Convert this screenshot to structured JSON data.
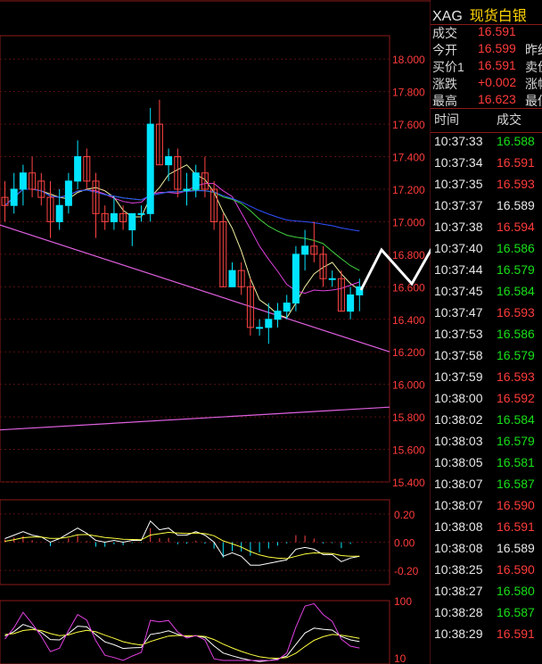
{
  "quote": {
    "symbol": "XAG",
    "name": "现货白银",
    "rows": [
      {
        "label": "成交",
        "value": "16.591",
        "extra": ""
      },
      {
        "label": "今开",
        "value": "16.599",
        "extra": "昨结"
      },
      {
        "label": "买价1",
        "value": "16.591",
        "extra": "卖价"
      },
      {
        "label": "涨跌",
        "value": "+0.002",
        "extra": "涨幅"
      },
      {
        "label": "最高",
        "value": "16.623",
        "extra": "最低"
      }
    ],
    "col_time": "时间",
    "col_price": "成交"
  },
  "ticks": [
    {
      "time": "10:37:33",
      "price": "16.588",
      "dir": "dn"
    },
    {
      "time": "10:37:34",
      "price": "16.591",
      "dir": "up"
    },
    {
      "time": "10:37:35",
      "price": "16.593",
      "dir": "up"
    },
    {
      "time": "10:37:37",
      "price": "16.589",
      "dir": "fl"
    },
    {
      "time": "10:37:38",
      "price": "16.594",
      "dir": "up"
    },
    {
      "time": "10:37:40",
      "price": "16.586",
      "dir": "dn"
    },
    {
      "time": "10:37:44",
      "price": "16.579",
      "dir": "dn"
    },
    {
      "time": "10:37:45",
      "price": "16.584",
      "dir": "dn"
    },
    {
      "time": "10:37:47",
      "price": "16.593",
      "dir": "up"
    },
    {
      "time": "10:37:53",
      "price": "16.586",
      "dir": "dn"
    },
    {
      "time": "10:37:58",
      "price": "16.579",
      "dir": "dn"
    },
    {
      "time": "10:37:59",
      "price": "16.593",
      "dir": "up"
    },
    {
      "time": "10:38:00",
      "price": "16.592",
      "dir": "up"
    },
    {
      "time": "10:38:02",
      "price": "16.584",
      "dir": "dn"
    },
    {
      "time": "10:38:03",
      "price": "16.579",
      "dir": "dn"
    },
    {
      "time": "10:38:05",
      "price": "16.581",
      "dir": "dn"
    },
    {
      "time": "10:38:07",
      "price": "16.587",
      "dir": "dn"
    },
    {
      "time": "10:38:07",
      "price": "16.590",
      "dir": "up"
    },
    {
      "time": "10:38:08",
      "price": "16.591",
      "dir": "up"
    },
    {
      "time": "10:38:08",
      "price": "16.589",
      "dir": "fl"
    },
    {
      "time": "10:38:25",
      "price": "16.590",
      "dir": "up"
    },
    {
      "time": "10:38:27",
      "price": "16.580",
      "dir": "dn"
    },
    {
      "time": "10:38:28",
      "price": "16.587",
      "dir": "dn"
    },
    {
      "time": "10:38:29",
      "price": "16.591",
      "dir": "up"
    }
  ],
  "colors": {
    "up": "#ff3b3b",
    "down": "#19e019",
    "bull_candle": "#00e5ff",
    "bear_candle": "#ff4444",
    "frame": "#8b1a1a",
    "axis_label": "#ff3b3b",
    "ma5": "#f0f0a0",
    "ma10": "#e040e0",
    "ma20": "#40d040",
    "ma60": "#3050ff",
    "trendline": "#e060e0",
    "arrow": "#ffffff"
  },
  "chart_data": {
    "type": "candlestick",
    "price_axis": {
      "ylim": [
        15.4,
        18.1
      ],
      "ticks": [
        "18.000",
        "17.800",
        "17.600",
        "17.400",
        "17.200",
        "17.000",
        "16.800",
        "16.600",
        "16.400",
        "16.200",
        "16.000",
        "15.800",
        "15.600",
        "15.400"
      ]
    },
    "candles": [
      {
        "o": 17.15,
        "h": 17.25,
        "l": 17.0,
        "c": 17.1
      },
      {
        "o": 17.1,
        "h": 17.3,
        "l": 17.05,
        "c": 17.2
      },
      {
        "o": 17.2,
        "h": 17.35,
        "l": 17.1,
        "c": 17.3
      },
      {
        "o": 17.3,
        "h": 17.4,
        "l": 17.15,
        "c": 17.2
      },
      {
        "o": 17.25,
        "h": 17.3,
        "l": 17.1,
        "c": 17.15
      },
      {
        "o": 17.15,
        "h": 17.25,
        "l": 16.9,
        "c": 17.0
      },
      {
        "o": 17.0,
        "h": 17.2,
        "l": 16.95,
        "c": 17.1
      },
      {
        "o": 17.1,
        "h": 17.3,
        "l": 17.05,
        "c": 17.25
      },
      {
        "o": 17.25,
        "h": 17.5,
        "l": 17.2,
        "c": 17.4
      },
      {
        "o": 17.4,
        "h": 17.45,
        "l": 17.2,
        "c": 17.25
      },
      {
        "o": 17.25,
        "h": 17.3,
        "l": 16.9,
        "c": 17.05
      },
      {
        "o": 17.05,
        "h": 17.1,
        "l": 16.95,
        "c": 17.0
      },
      {
        "o": 17.0,
        "h": 17.15,
        "l": 16.95,
        "c": 17.05
      },
      {
        "o": 17.05,
        "h": 17.1,
        "l": 16.95,
        "c": 17.0
      },
      {
        "o": 16.95,
        "h": 17.05,
        "l": 16.85,
        "c": 17.05
      },
      {
        "o": 17.05,
        "h": 17.1,
        "l": 17.0,
        "c": 17.05
      },
      {
        "o": 17.05,
        "h": 17.7,
        "l": 17.0,
        "c": 17.6
      },
      {
        "o": 17.6,
        "h": 17.75,
        "l": 17.35,
        "c": 17.35
      },
      {
        "o": 17.35,
        "h": 17.45,
        "l": 17.25,
        "c": 17.4
      },
      {
        "o": 17.4,
        "h": 17.45,
        "l": 17.15,
        "c": 17.2
      },
      {
        "o": 17.2,
        "h": 17.3,
        "l": 17.1,
        "c": 17.2
      },
      {
        "o": 17.2,
        "h": 17.35,
        "l": 17.15,
        "c": 17.3
      },
      {
        "o": 17.3,
        "h": 17.4,
        "l": 17.15,
        "c": 17.2
      },
      {
        "o": 17.2,
        "h": 17.25,
        "l": 16.95,
        "c": 17.0
      },
      {
        "o": 17.0,
        "h": 17.05,
        "l": 16.6,
        "c": 16.6
      },
      {
        "o": 16.6,
        "h": 16.75,
        "l": 16.6,
        "c": 16.7
      },
      {
        "o": 16.7,
        "h": 16.75,
        "l": 16.55,
        "c": 16.6
      },
      {
        "o": 16.6,
        "h": 16.65,
        "l": 16.3,
        "c": 16.35
      },
      {
        "o": 16.35,
        "h": 16.4,
        "l": 16.3,
        "c": 16.35
      },
      {
        "o": 16.35,
        "h": 16.5,
        "l": 16.25,
        "c": 16.4
      },
      {
        "o": 16.4,
        "h": 16.5,
        "l": 16.35,
        "c": 16.45
      },
      {
        "o": 16.45,
        "h": 16.55,
        "l": 16.4,
        "c": 16.5
      },
      {
        "o": 16.5,
        "h": 16.85,
        "l": 16.45,
        "c": 16.8
      },
      {
        "o": 16.8,
        "h": 16.95,
        "l": 16.7,
        "c": 16.85
      },
      {
        "o": 16.85,
        "h": 17.0,
        "l": 16.75,
        "c": 16.8
      },
      {
        "o": 16.8,
        "h": 16.85,
        "l": 16.6,
        "c": 16.65
      },
      {
        "o": 16.65,
        "h": 16.7,
        "l": 16.6,
        "c": 16.65
      },
      {
        "o": 16.65,
        "h": 16.7,
        "l": 16.45,
        "c": 16.45
      },
      {
        "o": 16.45,
        "h": 16.6,
        "l": 16.4,
        "c": 16.55
      },
      {
        "o": 16.55,
        "h": 16.65,
        "l": 16.45,
        "c": 16.6
      }
    ],
    "macd": {
      "ylim": [
        -0.3,
        0.3
      ],
      "ticks": [
        "0.20",
        "0.00",
        "-0.20"
      ]
    },
    "kdj": {
      "ylim": [
        10,
        100
      ],
      "ticks": [
        "100",
        "10"
      ]
    }
  }
}
